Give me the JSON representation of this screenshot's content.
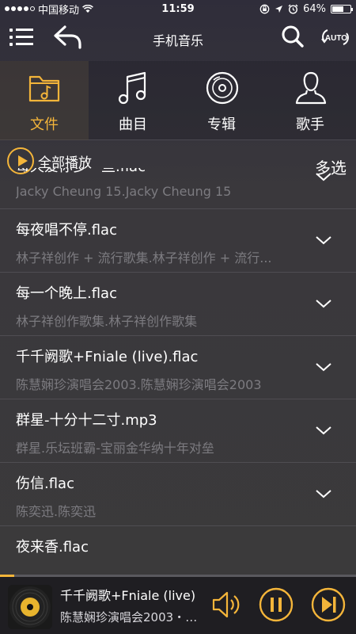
{
  "status_bar": {
    "carrier": "中国移动",
    "time": "11:59",
    "battery": "64%",
    "battery_level": 0.64,
    "signal_dots_filled": 4,
    "signal_dots_total": 5
  },
  "header": {
    "title": "手机音乐",
    "auto_label": "AUTO"
  },
  "categories": [
    {
      "label": "文件",
      "icon": "folder-music-icon",
      "active": true
    },
    {
      "label": "曲目",
      "icon": "music-note-icon",
      "active": false
    },
    {
      "label": "专辑",
      "icon": "disc-icon",
      "active": false
    },
    {
      "label": "歌手",
      "icon": "person-icon",
      "active": false
    }
  ],
  "toolbar": {
    "play_all": "全部播放",
    "multi_select": "多选"
  },
  "songs": [
    {
      "title": "每天爱你多一些.flac",
      "subtitle": "Jacky Cheung 15.Jacky Cheung 15"
    },
    {
      "title": "每夜唱不停.flac",
      "subtitle": "林子祥创作 + 流行歌集.林子祥创作 + 流行..."
    },
    {
      "title": "每一个晚上.flac",
      "subtitle": "林子祥创作歌集.林子祥创作歌集"
    },
    {
      "title": "千千阙歌+Fniale (live).flac",
      "subtitle": "陈慧娴珍演唱会2003.陈慧娴珍演唱会2003"
    },
    {
      "title": "群星-十分十二寸.mp3",
      "subtitle": "群星.乐坛班霸-宝丽金华纳十年对垒"
    },
    {
      "title": "伤信.flac",
      "subtitle": "陈奕迅.陈奕迅"
    },
    {
      "title": "夜来香.flac",
      "subtitle": ""
    }
  ],
  "player": {
    "title": "千千阙歌+Fniale (live)",
    "subtitle": "陈慧娴珍演唱会2003・陈...",
    "progress": 0.04
  },
  "colors": {
    "accent": "#f4b53a",
    "background": "#3a383c",
    "subtitle_gray": "#7c7b80",
    "player_bg": "#1f1e22"
  }
}
